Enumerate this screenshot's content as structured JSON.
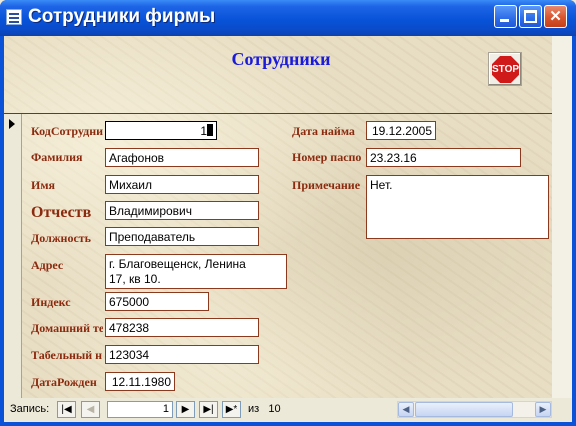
{
  "window": {
    "title": "Сотрудники фирмы"
  },
  "header": {
    "title": "Сотрудники",
    "stop_label": "STOP"
  },
  "fields": {
    "id": {
      "label": "КодСотрудни",
      "value": "1"
    },
    "lastname": {
      "label": "Фамилия",
      "value": "Агафонов"
    },
    "firstname": {
      "label": "Имя",
      "value": "Михаил"
    },
    "patronymic": {
      "label": "Отчеств",
      "value": "Владимирович"
    },
    "position": {
      "label": "Должность",
      "value": "Преподаватель"
    },
    "address": {
      "label": "Адрес",
      "value": "г. Благовещенск, Ленина\n17, кв 10."
    },
    "zip": {
      "label": "Индекс",
      "value": "675000"
    },
    "home_phone": {
      "label": "Домашний те",
      "value": "478238"
    },
    "tab_no": {
      "label": "Табельный н",
      "value": "123034"
    },
    "birthdate": {
      "label": "ДатаРожден",
      "value": "12.11.1980"
    },
    "hire_date": {
      "label": "Дата найма",
      "value": "19.12.2005"
    },
    "passport": {
      "label": "Номер паспо",
      "value": "23.23.16"
    },
    "note": {
      "label": "Примечание",
      "value": "Нет."
    }
  },
  "navigation": {
    "record_label": "Запись:",
    "current": "1",
    "of_label": "из",
    "total": "10"
  }
}
